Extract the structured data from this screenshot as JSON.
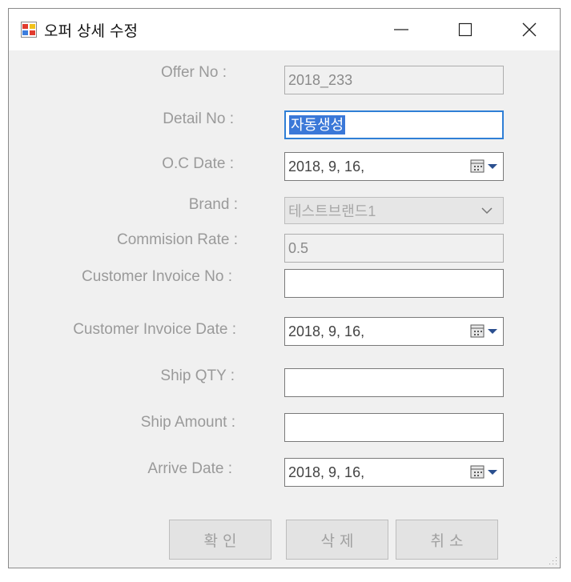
{
  "window": {
    "title": "오퍼 상세 수정"
  },
  "form": {
    "offer_no": {
      "label": "Offer No :",
      "value": "2018_233"
    },
    "detail_no": {
      "label": "Detail No :",
      "value": "자동생성"
    },
    "oc_date": {
      "label": "O.C Date :",
      "value": "2018,   9,  16,"
    },
    "brand": {
      "label": "Brand :",
      "value": "테스트브랜드1"
    },
    "commision_rate": {
      "label": "Commision Rate :",
      "value": "0.5"
    },
    "customer_invoice_no": {
      "label": "Customer Invoice No :",
      "value": ""
    },
    "customer_invoice_date": {
      "label": "Customer Invoice Date :",
      "value": "2018,   9,  16,"
    },
    "ship_qty": {
      "label": "Ship QTY :",
      "value": ""
    },
    "ship_amount": {
      "label": "Ship Amount :",
      "value": ""
    },
    "arrive_date": {
      "label": "Arrive Date :",
      "value": "2018,   9,  16,"
    }
  },
  "buttons": {
    "ok": "확 인",
    "delete": "삭 제",
    "cancel": "취 소"
  },
  "icons": {
    "app": "app-icon",
    "calendar": "calendar-icon",
    "dropdown": "chevron-down-icon"
  },
  "colors": {
    "selection": "#3a78d8",
    "focus_border": "#2f7fd6"
  }
}
